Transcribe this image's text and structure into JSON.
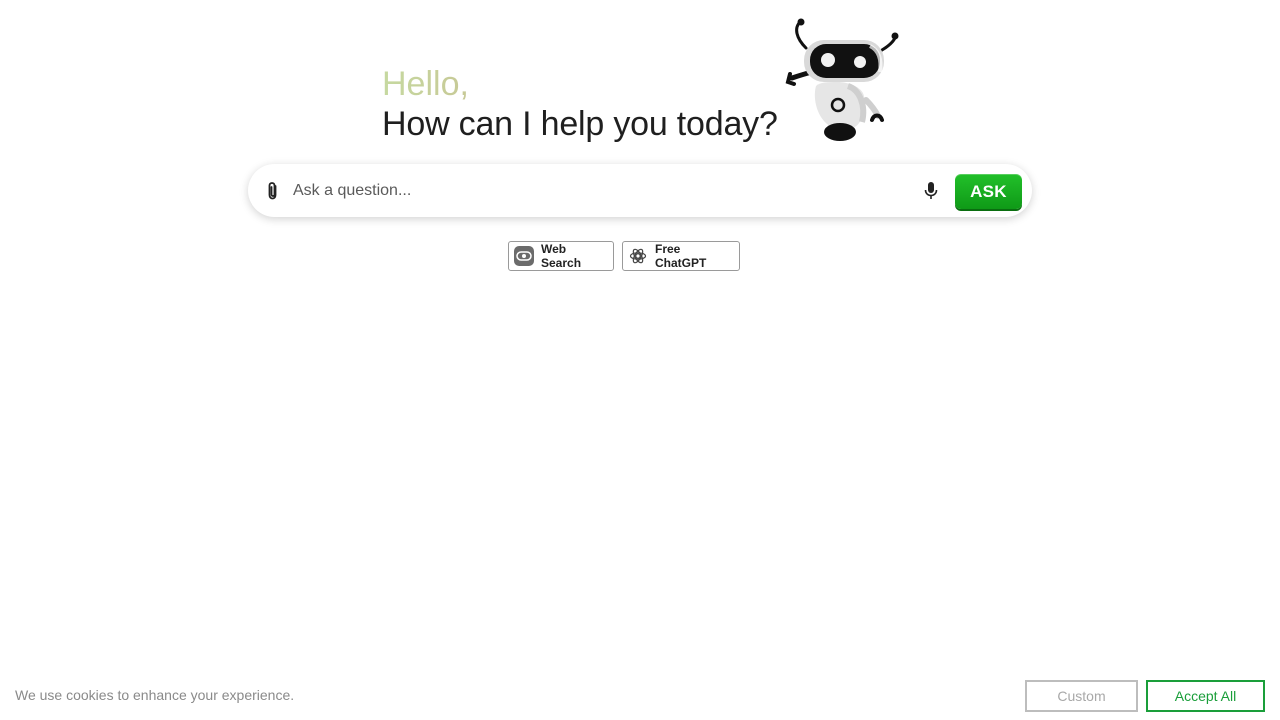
{
  "greeting": {
    "hello": "Hello,",
    "headline": "How can I help you today?"
  },
  "mascot": {
    "icon": "robot-mascot-icon"
  },
  "search": {
    "placeholder": "Ask a question...",
    "value": "",
    "attach_icon": "paperclip-icon",
    "mic_icon": "microphone-icon",
    "ask_label": "ASK"
  },
  "chips": [
    {
      "label": "Web Search",
      "icon": "web-search-icon"
    },
    {
      "label": "Free ChatGPT",
      "icon": "openai-icon"
    }
  ],
  "cookie": {
    "message": "We use cookies to enhance your experience.",
    "custom_label": "Custom",
    "accept_label": "Accept All"
  },
  "colors": {
    "ask_button": "#13a81c",
    "accept_accent": "#1a9e3a",
    "hello_gradient_start": "#c6d9a0",
    "hello_gradient_end": "#c69a74"
  }
}
